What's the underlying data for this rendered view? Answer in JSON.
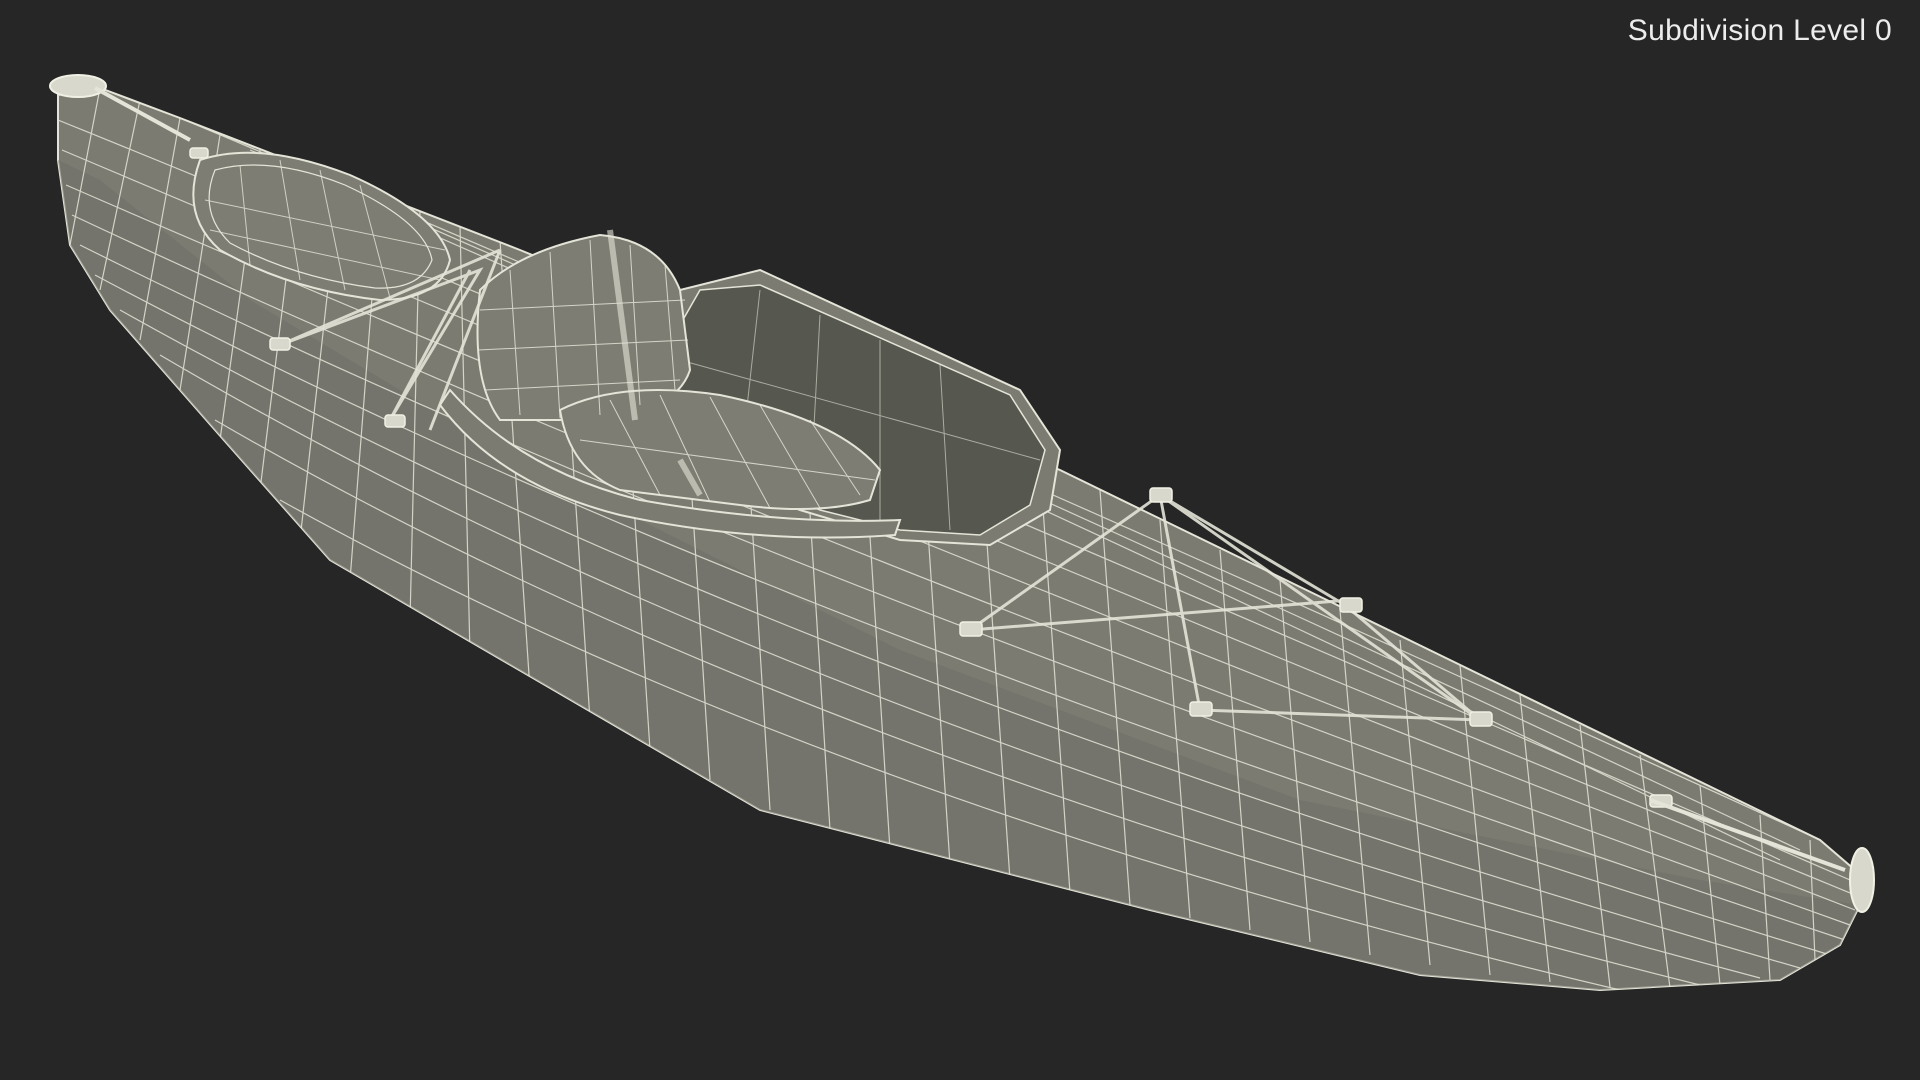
{
  "viewport": {
    "overlay_label": "Subdivision Level 0",
    "background_color": "#262626",
    "render_mode": "wireframe over shaded"
  },
  "model": {
    "subject": "kayak",
    "surface_color": "#7b7b71",
    "wire_color": "#e4e4d8",
    "cockpit_color": "#56574f"
  }
}
